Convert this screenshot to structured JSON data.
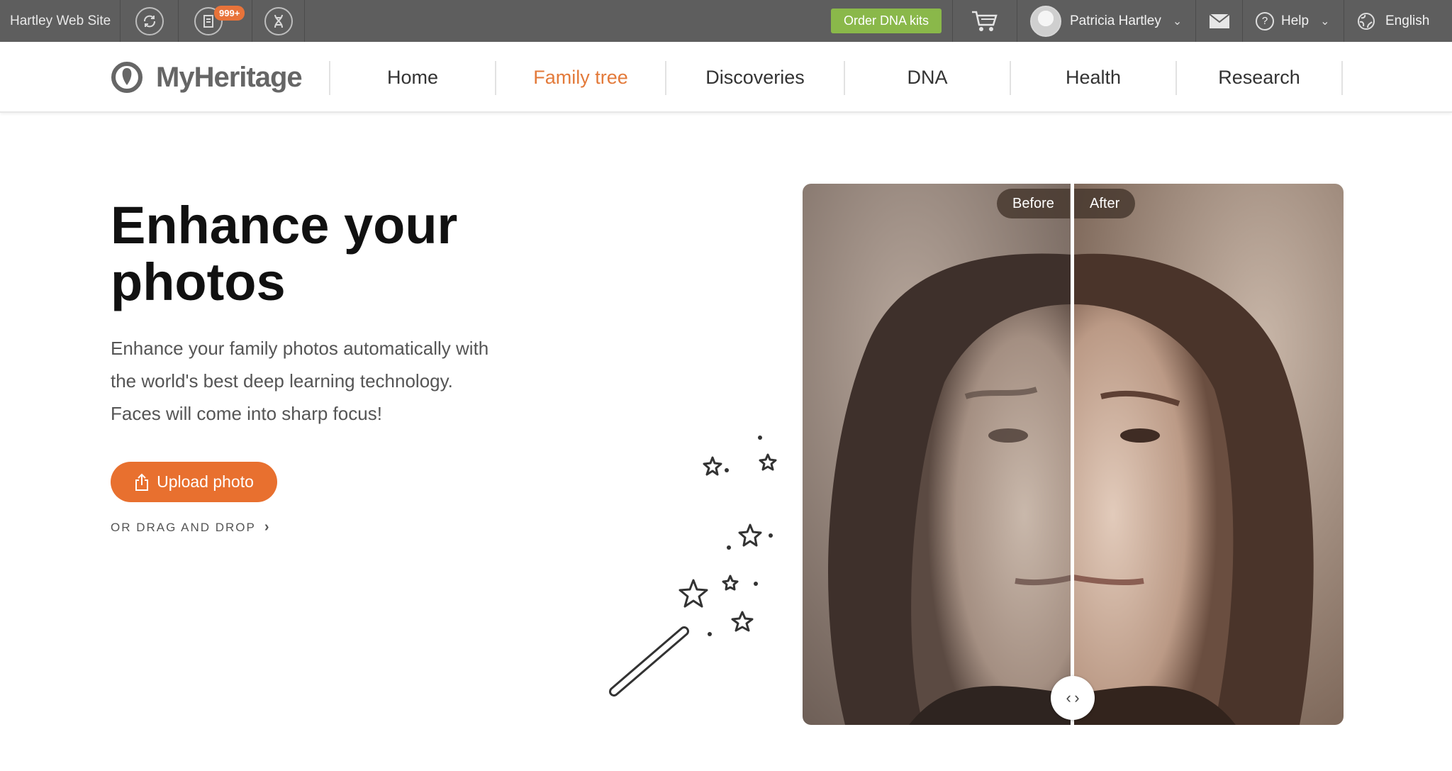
{
  "topbar": {
    "site_name": "Hartley Web Site",
    "notifications_badge": "999+",
    "order_button": "Order DNA kits",
    "user_name": "Patricia Hartley",
    "help_label": "Help",
    "language_label": "English"
  },
  "nav": {
    "logo_text": "MyHeritage",
    "items": [
      {
        "label": "Home"
      },
      {
        "label": "Family tree"
      },
      {
        "label": "Discoveries"
      },
      {
        "label": "DNA"
      },
      {
        "label": "Health"
      },
      {
        "label": "Research"
      }
    ],
    "active_item": "Family tree"
  },
  "hero": {
    "title_line1": "Enhance your",
    "title_line2": "photos",
    "desc_line1": "Enhance your family photos automatically with",
    "desc_line2": "the world's best deep learning technology.",
    "desc_line3": "Faces will come into sharp focus!",
    "upload_button": "Upload photo",
    "drag_drop": "OR DRAG AND DROP"
  },
  "compare": {
    "before_label": "Before",
    "after_label": "After"
  },
  "colors": {
    "accent": "#e8702f",
    "active_nav": "#e37a3a",
    "order_btn": "#8ab84a",
    "topbar_bg": "#5e5e5e"
  }
}
